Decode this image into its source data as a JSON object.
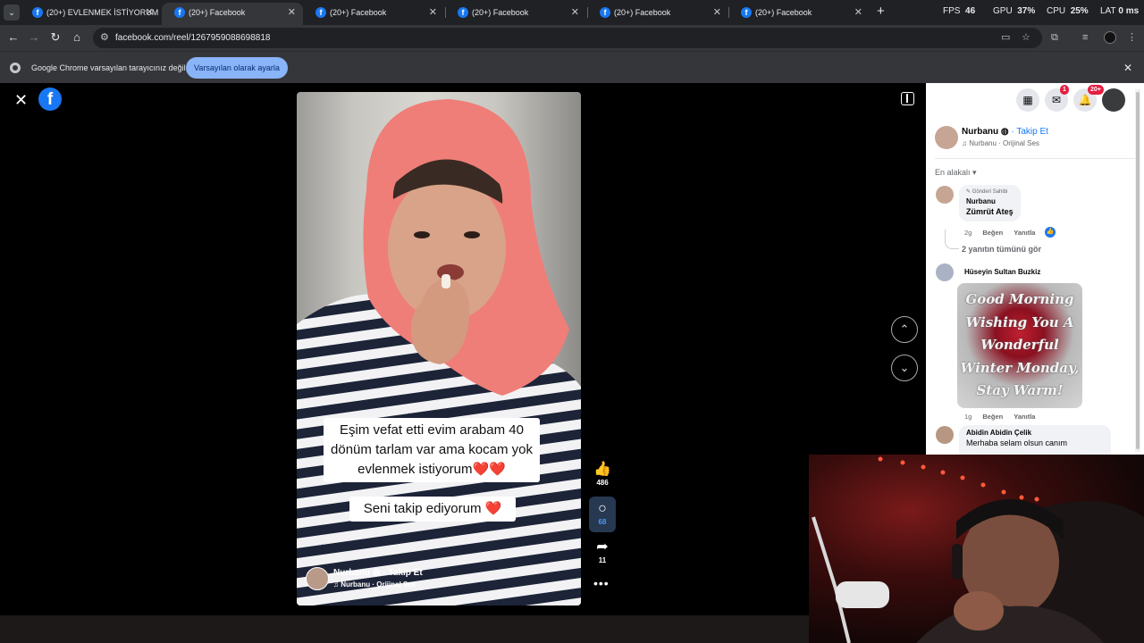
{
  "browser": {
    "tabs": [
      {
        "title": "(20+) EVLENMEK İSTİYORUM | "
      },
      {
        "title": "(20+) Facebook"
      },
      {
        "title": "(20+) Facebook"
      },
      {
        "title": "(20+) Facebook"
      },
      {
        "title": "(20+) Facebook"
      },
      {
        "title": "(20+) Facebook"
      }
    ],
    "new_tab": "+",
    "perf": {
      "fps_label": "FPS",
      "fps": "46",
      "gpu_label": "GPU",
      "gpu": "37%",
      "cpu_label": "CPU",
      "cpu": "25%",
      "lat_label": "LAT",
      "lat": "0 ms"
    },
    "url": "facebook.com/reel/1267959088698818",
    "infobar_text": "Google Chrome varsayılan tarayıcınız değil",
    "infobar_button": "Varsayılan olarak ayarla"
  },
  "reel": {
    "caption_main": "Eşim vefat etti evim arabam 40 dönüm tarlam var ama kocam yok evlenmek istiyorum❤️❤️",
    "caption_follow": "Seni takip ediyorum ❤️",
    "author": {
      "name": "Nurbanu",
      "follow": "Takip Et",
      "audio": "Nurbanu · Orijinal Ses"
    },
    "actions": {
      "likes": "486",
      "comments": "68",
      "shares": "11"
    }
  },
  "panel": {
    "header": {
      "messenger_badge": "1",
      "notif_badge": "20+"
    },
    "post_author": {
      "name": "Nurbanu",
      "follow": "· Takip Et",
      "audio": "Nurbanu · Orijinal Ses"
    },
    "sort_label": "En alakalı",
    "comments": [
      {
        "owner_label": "Gönderi Sahibi",
        "name": "Nurbanu",
        "text": "Zümrüt Ateş",
        "time": "2g",
        "like": "Beğen",
        "reply": "Yanıtla"
      },
      {
        "name": "Hüseyin Sultan Buzkiz",
        "gif_text": "Good Morning Wishing You A Wonderful Winter Monday, Stay Warm!",
        "time": "1g",
        "like": "Beğen",
        "reply": "Yanıtla"
      },
      {
        "name": "Abidin Abidin Çelik",
        "text": "Merhaba selam olsun canım"
      }
    ],
    "see_replies": "2 yanıtın tümünü gör"
  }
}
